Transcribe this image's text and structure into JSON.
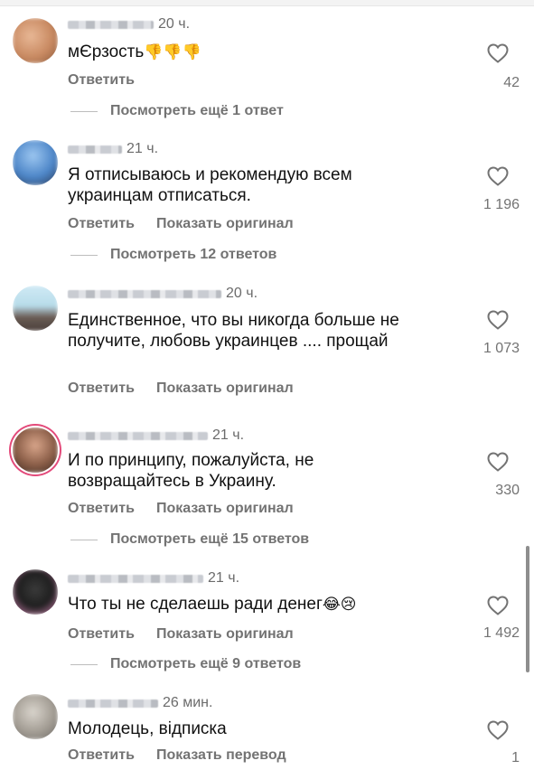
{
  "comments": [
    {
      "time": "20 ч.",
      "text": "мЄрзость",
      "emoji": "👎👎👎",
      "reply": "Ответить",
      "translate": "",
      "likes": "42",
      "more": "Посмотреть ещё 1 ответ",
      "avatar_colors": [
        "#d9a27c",
        "#8b5a3c"
      ]
    },
    {
      "time": "21 ч.",
      "text": "Я отписываюсь и рекомендую всем украинцам отписаться.",
      "emoji": "",
      "reply": "Ответить",
      "translate": "Показать оригинал",
      "likes": "1 196",
      "more": "Посмотреть 12 ответов",
      "avatar_colors": [
        "#6aa0d8",
        "#3d4f6a"
      ]
    },
    {
      "time": "20 ч.",
      "text": "Единственное, что вы никогда больше не получите, любовь украинцев .... прощай",
      "emoji": "",
      "reply": "Ответить",
      "translate": "Показать оригинал",
      "likes": "1 073",
      "more": "",
      "avatar_colors": [
        "#bfe3f0",
        "#5a4e48"
      ]
    },
    {
      "time": "21 ч.",
      "text": "И по принципу, пожалуйста, не возвращайтесь в Украину.",
      "emoji": "",
      "reply": "Ответить",
      "translate": "Показать оригинал",
      "likes": "330",
      "more": "Посмотреть ещё 15 ответов",
      "avatar_colors": [
        "#c08a6a",
        "#3b2a22"
      ]
    },
    {
      "time": "21 ч.",
      "text": "Что ты не сделаешь ради денег",
      "emoji": "😂😢",
      "reply": "Ответить",
      "translate": "Показать оригинал",
      "likes": "1 492",
      "more": "Посмотреть ещё 9 ответов",
      "avatar_colors": [
        "#c47aa6",
        "#2a2a2a"
      ]
    },
    {
      "time": "26 мин.",
      "text": "Молодець, відписка",
      "emoji": "",
      "reply": "Ответить",
      "translate": "Показать перевод",
      "likes": "1",
      "more": "",
      "avatar_colors": [
        "#c8c2b8",
        "#6d6a66"
      ]
    }
  ],
  "icons": {
    "like": "heart-outline-icon"
  },
  "colors": {
    "secondary_text": "#737373",
    "primary_text": "#111111"
  }
}
